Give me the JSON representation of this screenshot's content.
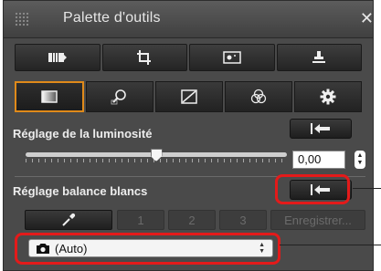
{
  "palette": {
    "title": "Palette d'outils",
    "close_glyph": "✕"
  },
  "tools": [
    {
      "icon": "compare-icon"
    },
    {
      "icon": "crop-icon"
    },
    {
      "icon": "image-dust-icon"
    },
    {
      "icon": "stamp-icon"
    }
  ],
  "tabs": [
    {
      "icon": "basic-adjust-icon",
      "active": true
    },
    {
      "icon": "detail-zoom-icon",
      "active": false
    },
    {
      "icon": "tone-curve-icon",
      "active": false
    },
    {
      "icon": "color-adjust-icon",
      "active": false
    },
    {
      "icon": "gear-icon",
      "active": false
    }
  ],
  "brightness": {
    "label": "Réglage de la luminosité",
    "value": "0,00",
    "slider_fraction": 0.5
  },
  "white_balance": {
    "label": "Réglage balance blancs",
    "buttons": [
      "1",
      "2",
      "3"
    ],
    "save_label": "Enregistrer...",
    "select_value": "(Auto)"
  },
  "colors": {
    "highlight": "#e41a1a",
    "active_tab": "#e08a1a"
  }
}
